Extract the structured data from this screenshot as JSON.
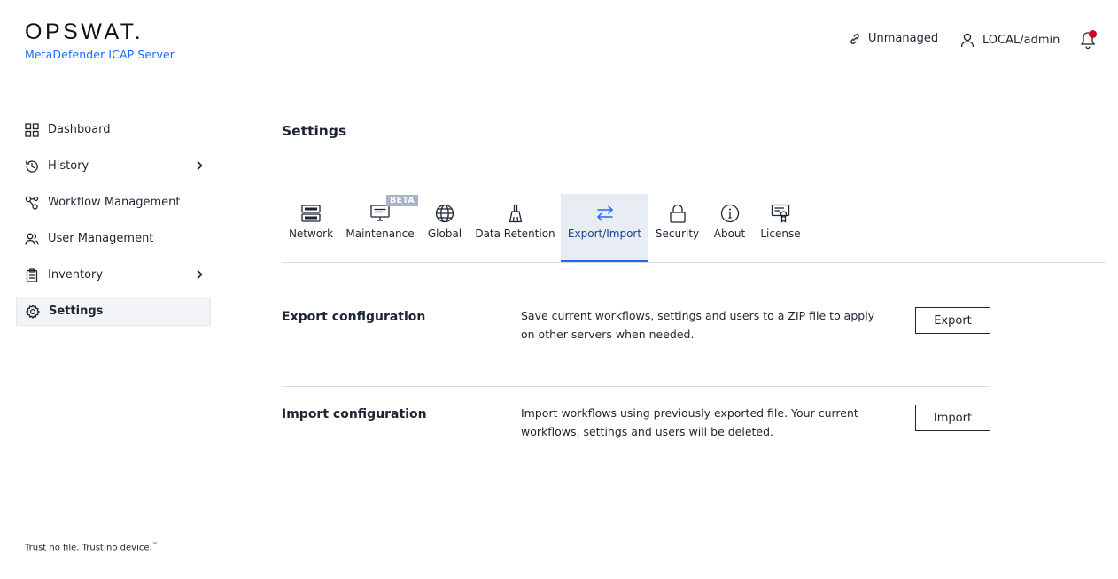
{
  "brand": {
    "logo_text": "OPSWAT.",
    "product": "MetaDefender ICAP Server"
  },
  "header": {
    "unmanaged_label": "Unmanaged",
    "user_label": "LOCAL/admin",
    "notification_dot_color": "#d0021b"
  },
  "sidebar": {
    "items": [
      {
        "label": "Dashboard",
        "icon": "grid-icon"
      },
      {
        "label": "History",
        "icon": "history-icon",
        "expandable": true
      },
      {
        "label": "Workflow Management",
        "icon": "workflow-icon"
      },
      {
        "label": "User Management",
        "icon": "users-icon"
      },
      {
        "label": "Inventory",
        "icon": "clipboard-icon",
        "expandable": true
      },
      {
        "label": "Settings",
        "icon": "gear-icon",
        "active": true
      }
    ]
  },
  "page": {
    "title": "Settings"
  },
  "tabs": [
    {
      "label": "Network",
      "icon": "server-icon"
    },
    {
      "label": "Maintenance",
      "icon": "monitor-icon",
      "badge": "BETA"
    },
    {
      "label": "Global",
      "icon": "globe-icon"
    },
    {
      "label": "Data Retention",
      "icon": "broom-icon"
    },
    {
      "label": "Export/Import",
      "icon": "arrows-swap-icon",
      "active": true
    },
    {
      "label": "Security",
      "icon": "lock-icon"
    },
    {
      "label": "About",
      "icon": "info-icon"
    },
    {
      "label": "License",
      "icon": "certificate-icon"
    }
  ],
  "sections": {
    "export": {
      "title": "Export configuration",
      "description": "Save current workflows, settings and users to a ZIP file to apply on other servers when needed.",
      "button": "Export"
    },
    "import": {
      "title": "Import configuration",
      "description": "Import workflows using previously exported file. Your current workflows, settings and users will be deleted.",
      "button": "Import"
    }
  },
  "footer": {
    "tagline": "Trust no file. Trust no device.",
    "trademark": "™"
  },
  "colors": {
    "accent": "#1d6bfc",
    "active_tab_bg": "#e8ecf3",
    "text": "#1d2533"
  }
}
